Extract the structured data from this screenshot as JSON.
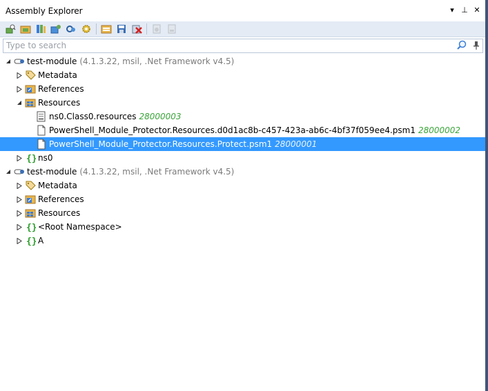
{
  "panel": {
    "title": "Assembly Explorer",
    "controls": [
      "▾",
      "⊥",
      "✕"
    ]
  },
  "toolbar": {
    "buttons": [
      {
        "icon": "open-icon"
      },
      {
        "icon": "open-from-gac-icon"
      },
      {
        "icon": "open-from-nuget-icon"
      },
      {
        "icon": "open-from-package-icon"
      },
      {
        "icon": "open-from-dotpeek-icon"
      },
      {
        "icon": "settings-icon"
      },
      {
        "icon": "assembly-list-icon"
      },
      {
        "icon": "save-icon"
      },
      {
        "icon": "remove-icon"
      },
      {
        "icon": "export-icon",
        "disabled": true
      },
      {
        "icon": "export-pdb-icon",
        "disabled": true
      }
    ]
  },
  "search": {
    "placeholder": "Type to search",
    "value": ""
  },
  "tree": {
    "rows": [
      {
        "name": "test-module",
        "detail": "(4.1.3.22, msil, .Net Framework v4.5)"
      },
      {
        "name": "Metadata"
      },
      {
        "name": "References"
      },
      {
        "name": "Resources"
      },
      {
        "name": "ns0.Class0.resources",
        "meta": "28000003"
      },
      {
        "name": "PowerShell_Module_Protector.Resources.d0d1ac8b-c457-423a-ab6c-4bf37f059ee4.psm1",
        "meta": "28000002"
      },
      {
        "name": "PowerShell_Module_Protector.Resources.Protect.psm1",
        "meta": "28000001"
      },
      {
        "name": "ns0"
      },
      {
        "name": "test-module",
        "detail": "(4.1.3.22, msil, .Net Framework v4.5)"
      },
      {
        "name": "Metadata"
      },
      {
        "name": "References"
      },
      {
        "name": "Resources"
      },
      {
        "name": "<Root Namespace>"
      },
      {
        "name": "A"
      }
    ]
  },
  "colors": {
    "selection": "#3399ff",
    "token": "#3aa53a",
    "toolbar_bg": "#e4ebf5",
    "side_border": "#41557a"
  }
}
